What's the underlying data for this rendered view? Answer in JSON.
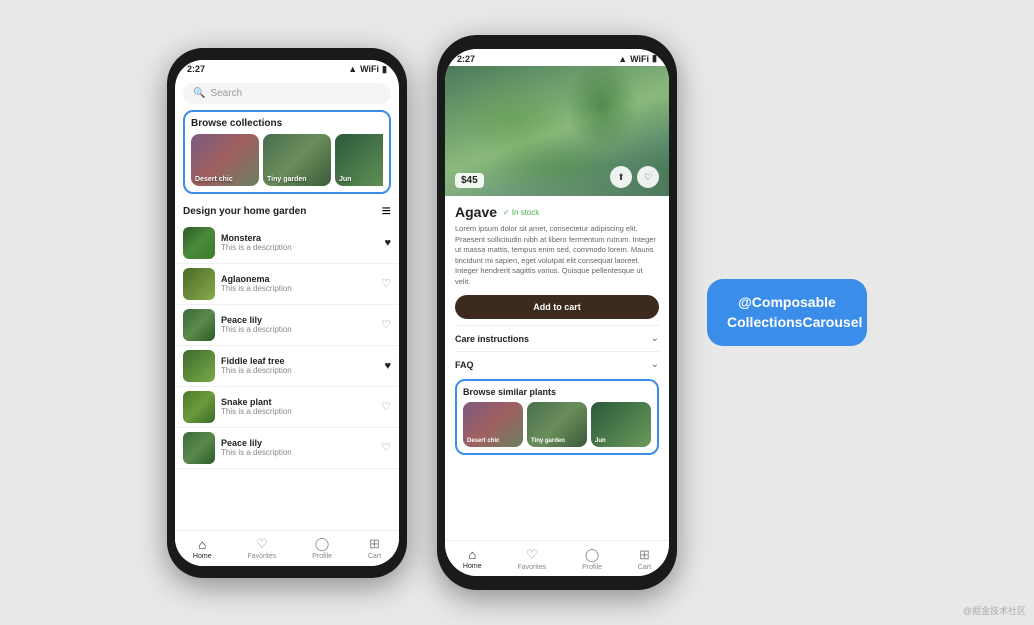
{
  "leftPhone": {
    "statusBar": {
      "time": "2:27",
      "icons": [
        "signal",
        "wifi",
        "battery"
      ]
    },
    "search": {
      "placeholder": "Search"
    },
    "browseSection": {
      "title": "Browse collections",
      "collections": [
        {
          "id": "desert-chic",
          "label": "Desert chic",
          "cardClass": "card-desert"
        },
        {
          "id": "tiny-garden",
          "label": "Tiny garden",
          "cardClass": "card-tiny"
        },
        {
          "id": "jun",
          "label": "Jun",
          "cardClass": "card-jun"
        }
      ]
    },
    "gardenSection": {
      "title": "Design your home garden",
      "plants": [
        {
          "name": "Monstera",
          "desc": "This is a description",
          "heartFilled": true,
          "thumbClass": "plant-monstera"
        },
        {
          "name": "Aglaonema",
          "desc": "This is a description",
          "heartFilled": false,
          "thumbClass": "plant-aglaonema"
        },
        {
          "name": "Peace lily",
          "desc": "This is a description",
          "heartFilled": false,
          "thumbClass": "plant-peacelily"
        },
        {
          "name": "Fiddle leaf tree",
          "desc": "This is a description",
          "heartFilled": true,
          "thumbClass": "plant-fiddle"
        },
        {
          "name": "Snake plant",
          "desc": "This is a description",
          "heartFilled": false,
          "thumbClass": "plant-snake"
        },
        {
          "name": "Peace lily",
          "desc": "This is a description",
          "heartFilled": false,
          "thumbClass": "plant-peacelily"
        }
      ]
    },
    "bottomNav": [
      {
        "label": "Home",
        "icon": "⌂",
        "active": true
      },
      {
        "label": "Favorites",
        "icon": "♡",
        "active": false
      },
      {
        "label": "Profile",
        "icon": "◯",
        "active": false
      },
      {
        "label": "Cart",
        "icon": "⊞",
        "active": false
      }
    ]
  },
  "rightPhone": {
    "statusBar": {
      "time": "2:27"
    },
    "product": {
      "price": "$45",
      "name": "Agave",
      "inStock": "In stock",
      "description": "Lorem ipsum dolor sit amet, consectetur adipiscing elit. Praesent sollicitudin nibh at libero fermentum rutrum. Integer ut massa mattis, tempus enim sed, commodo lorem. Mauris tincidunt mi sapien, eget volutpat elit consequat laoreet. Integer hendrerit sagittis varius. Quisque pellentesque ut velit.",
      "addToCartLabel": "Add to cart"
    },
    "accordion": [
      {
        "label": "Care instructions",
        "id": "care-instructions"
      },
      {
        "label": "FAQ",
        "id": "faq"
      }
    ],
    "similarSection": {
      "title": "Browse similar plants",
      "collections": [
        {
          "id": "desert-chic",
          "label": "Desert chic",
          "cardClass": "card-desert"
        },
        {
          "id": "tiny-garden",
          "label": "Tiny garden",
          "cardClass": "card-tiny"
        },
        {
          "id": "jun",
          "label": "Jun",
          "cardClass": "card-jun"
        }
      ]
    },
    "bottomNav": [
      {
        "label": "Home",
        "icon": "⌂",
        "active": true
      },
      {
        "label": "Favorites",
        "icon": "♡",
        "active": false
      },
      {
        "label": "Profile",
        "icon": "◯",
        "active": false
      },
      {
        "label": "Cart",
        "icon": "⊞",
        "active": false
      }
    ]
  },
  "annotation": {
    "line1": "@Composable",
    "line2": "CollectionsCarousel"
  },
  "watermark": "@掘金技术社区"
}
